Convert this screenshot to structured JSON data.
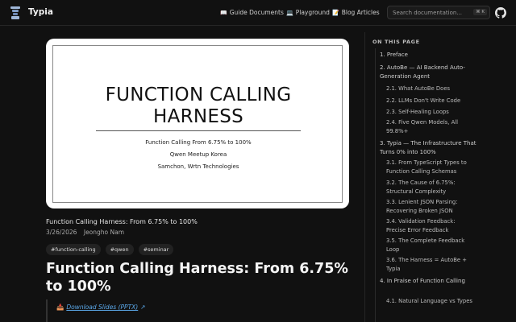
{
  "header": {
    "brand": "Typia",
    "nav": [
      {
        "icon": "book-icon",
        "glyph": "📖",
        "label": "Guide Documents"
      },
      {
        "icon": "laptop-icon",
        "glyph": "💻",
        "label": "Playground"
      },
      {
        "icon": "memo-icon",
        "glyph": "📝",
        "label": "Blog Articles"
      }
    ],
    "search_placeholder": "Search documentation...",
    "search_shortcut": "⌘ K"
  },
  "slide": {
    "title_line1": "FUNCTION CALLING",
    "title_line2": "HARNESS",
    "subtitle": "Function Calling From 6.75% to 100%",
    "event": "Qwen Meetup Korea",
    "author_org": "Samchon, Wrtn Technologies"
  },
  "post": {
    "small_title": "Function Calling Harness: From 6.75% to 100%",
    "date": "3/26/2026",
    "author": "Jeongho Nam",
    "tags": [
      "#function-calling",
      "#qwen",
      "#seminar"
    ],
    "heading": "Function Calling Harness: From 6.75% to 100%",
    "download_icon": "📥",
    "download_label": "Download Slides (PPTX)",
    "external_glyph": "↗"
  },
  "toc": {
    "heading": "ON THIS PAGE",
    "items": [
      {
        "label": "1. Preface",
        "level": 1
      },
      {
        "label": "2. AutoBe — AI Backend Auto-Generation Agent",
        "level": 1
      },
      {
        "label": "2.1. What AutoBe Does",
        "level": 2
      },
      {
        "label": "2.2. LLMs Don't Write Code",
        "level": 2
      },
      {
        "label": "2.3. Self-Healing Loops",
        "level": 2
      },
      {
        "label": "2.4. Five Qwen Models, All 99.8%+",
        "level": 2
      },
      {
        "label": "3. Typia — The Infrastructure That Turns 0% into 100%",
        "level": 1
      },
      {
        "label": "3.1. From TypeScript Types to Function Calling Schemas",
        "level": 2
      },
      {
        "label": "3.2. The Cause of 6.75%: Structural Complexity",
        "level": 2
      },
      {
        "label": "3.3. Lenient JSON Parsing: Recovering Broken JSON",
        "level": 2
      },
      {
        "label": "3.4. Validation Feedback: Precise Error Feedback",
        "level": 2
      },
      {
        "label": "3.5. The Complete Feedback Loop",
        "level": 2
      },
      {
        "label": "3.6. The Harness = AutoBe + Typia",
        "level": 2
      },
      {
        "label": "4. In Praise of Function Calling",
        "level": 1
      },
      {
        "label": "4.1. Natural Language vs Types",
        "level": 2
      }
    ]
  }
}
